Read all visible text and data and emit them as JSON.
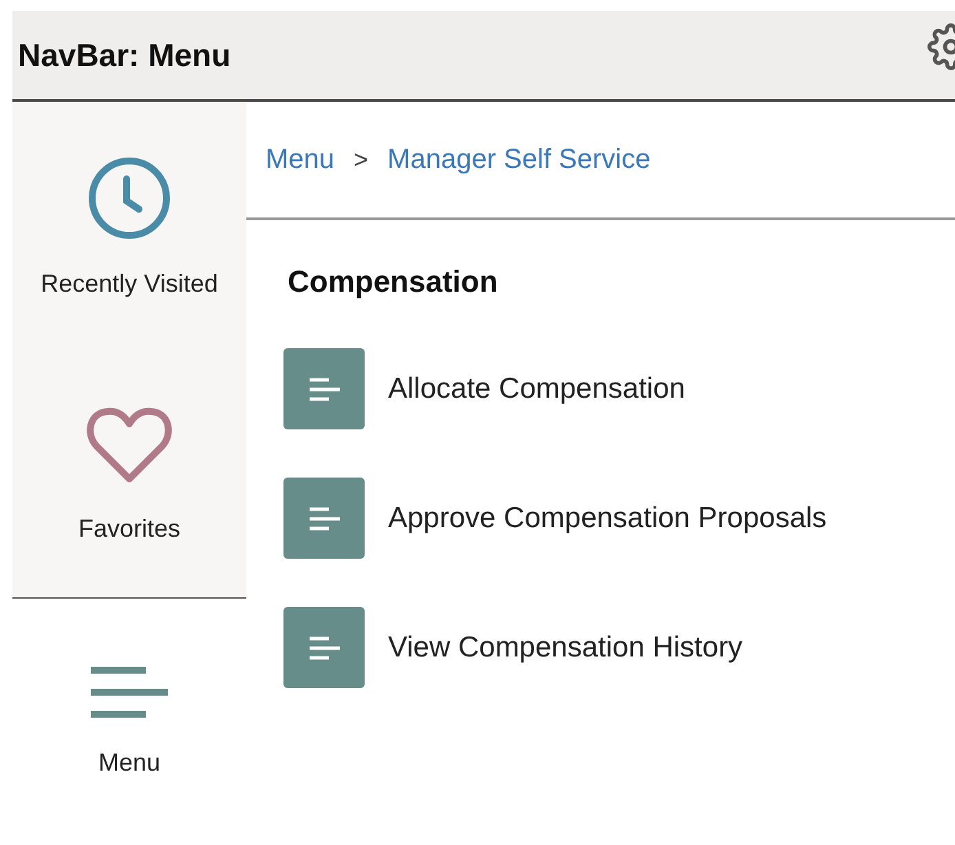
{
  "header": {
    "title": "NavBar: Menu"
  },
  "sidebar": {
    "items": [
      {
        "label": "Recently Visited",
        "kind": "clock",
        "selected": false
      },
      {
        "label": "Favorites",
        "kind": "heart",
        "selected": false
      },
      {
        "label": "Menu",
        "kind": "menu",
        "selected": true
      }
    ]
  },
  "breadcrumb": {
    "items": [
      "Menu",
      "Manager Self Service"
    ],
    "separator": ">"
  },
  "section": {
    "title": "Compensation",
    "items": [
      "Allocate Compensation",
      "Approve Compensation Proposals",
      "View Compensation History"
    ]
  }
}
